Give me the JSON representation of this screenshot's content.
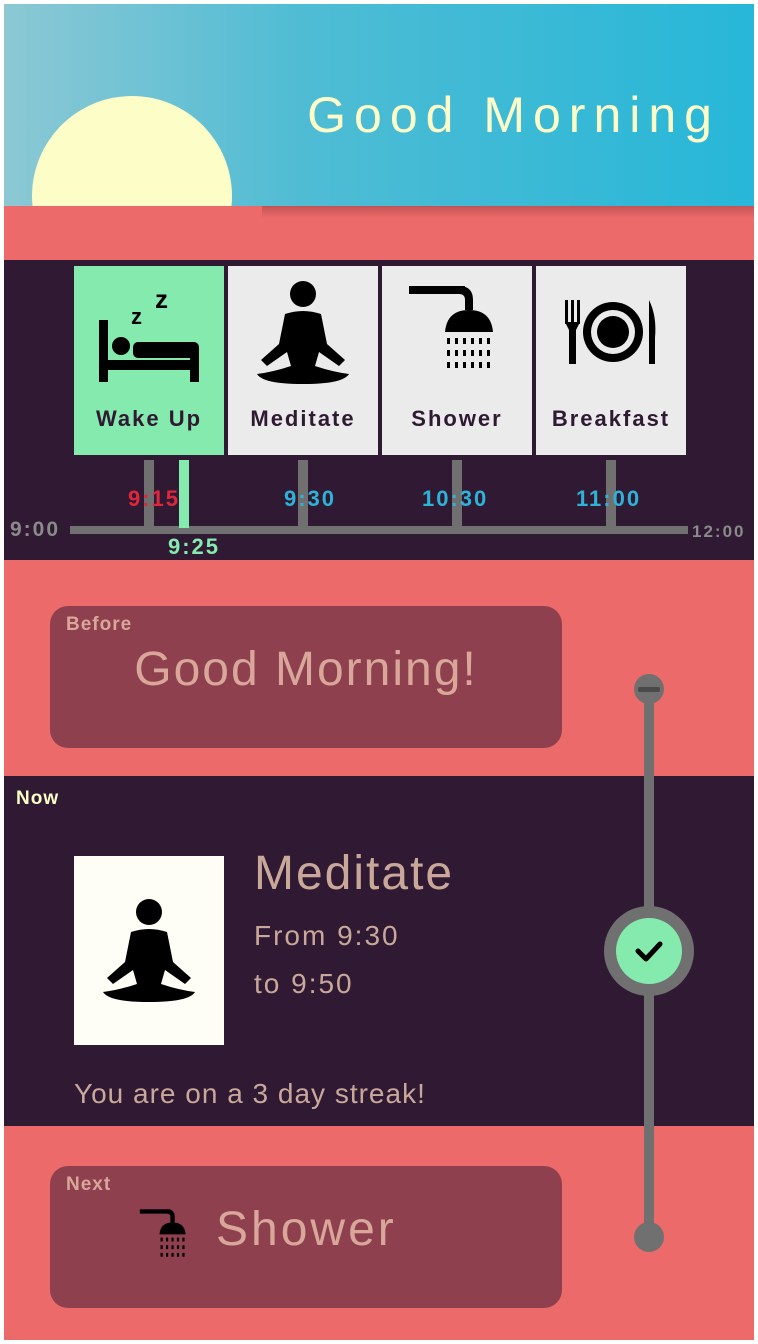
{
  "header": {
    "title": "Good Morning"
  },
  "timeline": {
    "cards": [
      {
        "label": "Wake Up",
        "icon": "sleep-icon",
        "active": true
      },
      {
        "label": "Meditate",
        "icon": "meditate-icon",
        "active": false
      },
      {
        "label": "Shower",
        "icon": "shower-icon",
        "active": false
      },
      {
        "label": "Breakfast",
        "icon": "breakfast-icon",
        "active": false
      }
    ],
    "axis_start": "9:00",
    "axis_end": "12:00",
    "times": [
      "9:15",
      "9:30",
      "10:30",
      "11:00"
    ],
    "current_time": "9:25"
  },
  "before": {
    "tag": "Before",
    "title": "Good Morning!"
  },
  "now": {
    "tag": "Now",
    "title": "Meditate",
    "from": "From 9:30",
    "to": "to 9:50",
    "streak": "You are on a 3 day streak!"
  },
  "next": {
    "tag": "Next",
    "title": "Shower",
    "icon": "shower-icon"
  },
  "colors": {
    "accent_green": "#84eaad",
    "coral": "#ec6a6a",
    "dark_plum": "#301a33",
    "cyan": "#2eb3d8",
    "past_red": "#e0263c",
    "cream": "#fdfdc8"
  }
}
